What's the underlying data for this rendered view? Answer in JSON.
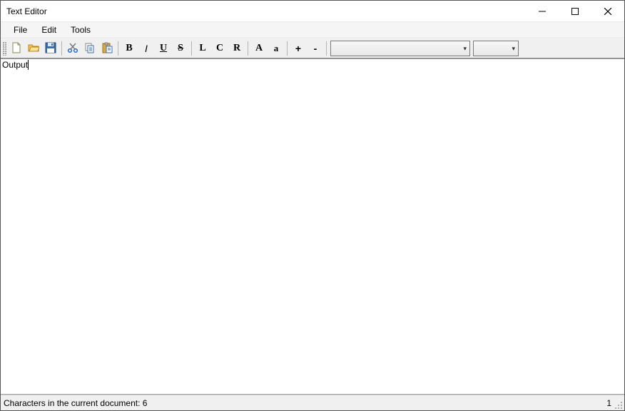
{
  "window": {
    "title": "Text Editor"
  },
  "menubar": {
    "file": "File",
    "edit": "Edit",
    "tools": "Tools"
  },
  "toolbar": {
    "bold": "B",
    "italic": "I",
    "underline": "U",
    "strike": "S",
    "align_left": "L",
    "align_center": "C",
    "align_right": "R",
    "uppercase": "A",
    "lowercase": "a",
    "size_up": "+",
    "size_down": "-",
    "font_family_value": "",
    "font_size_value": ""
  },
  "editor": {
    "content": "Output"
  },
  "statusbar": {
    "left": "Characters in the current document: 6",
    "right": "1"
  }
}
